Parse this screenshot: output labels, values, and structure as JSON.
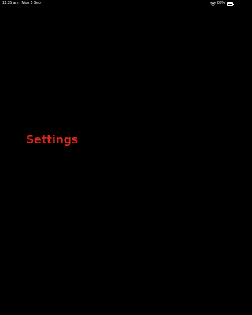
{
  "status_bar": {
    "time": "11:35 am",
    "date": "Mon 5 Sep",
    "battery_percent_label": "80%",
    "battery_level": 0.8,
    "icons": [
      "wifi-icon",
      "battery-icon"
    ]
  },
  "main": {
    "title": "Settings"
  },
  "colors": {
    "background": "#000000",
    "accent": "#e0261a",
    "status_text": "#ffffff"
  }
}
